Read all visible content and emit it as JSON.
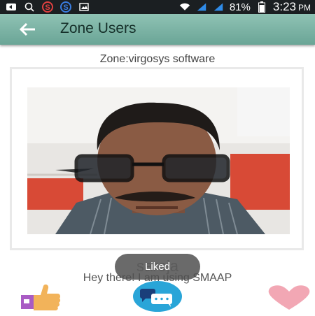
{
  "status_bar": {
    "battery": "81%",
    "time": "3:23",
    "ampm": "PM",
    "icons": [
      "usb-icon",
      "search-icon",
      "s-app-icon",
      "s-app-icon",
      "image-icon",
      "wifi-icon",
      "signal-icon",
      "signal-icon",
      "battery-icon"
    ]
  },
  "app_bar": {
    "title": "Zone Users",
    "back_icon": "arrow-left-icon"
  },
  "zone": {
    "label": "Zone:virgosys software"
  },
  "profile": {
    "username": "saroja",
    "status": "Hey there! I am using SMAAP"
  },
  "toast": {
    "text": "Liked"
  },
  "actions": {
    "like_icon": "thumbs-up-icon",
    "chat_icon": "chat-bubble-icon",
    "favorite_icon": "heart-icon"
  },
  "colors": {
    "status_bar": "#1b1f22",
    "app_bar": "#7fb5a6",
    "toast_bg": "#505050",
    "chat_button": "#29a5d8",
    "heart": "#f2a7b4",
    "thumb": "#f2b35a",
    "cuff": "#a95bc4"
  }
}
